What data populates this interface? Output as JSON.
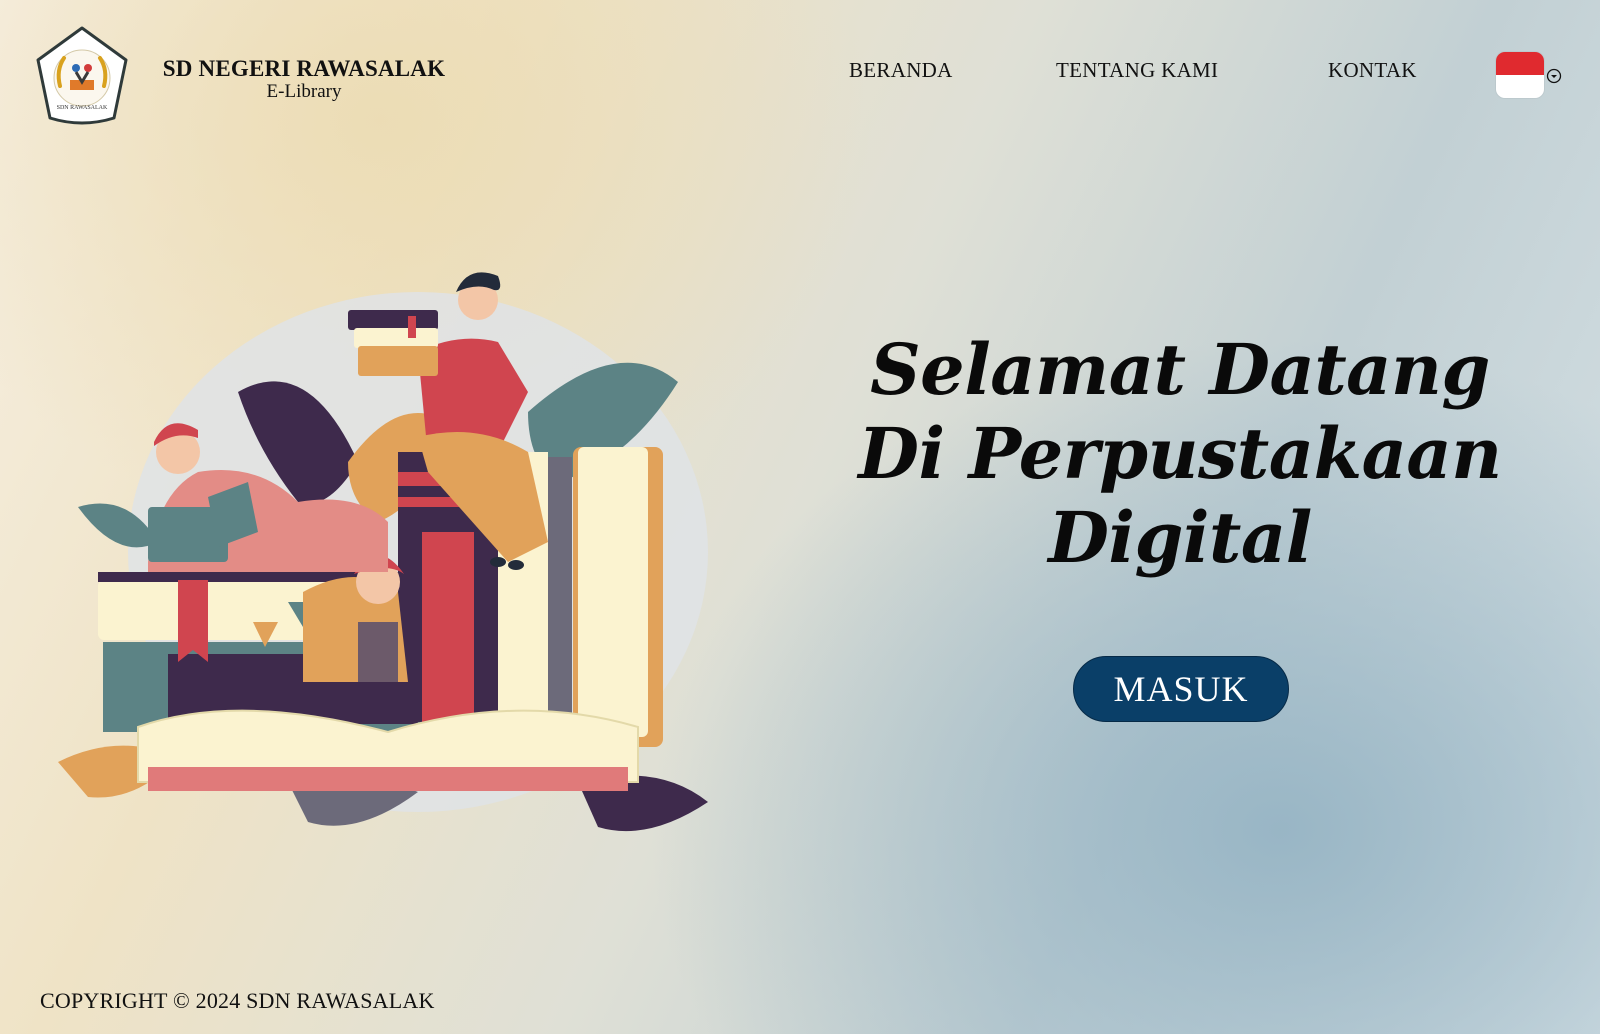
{
  "header": {
    "logo_icon": "school-emblem-icon",
    "logo_text": "SDN RAWASALAK",
    "school_name": "SD NEGERI RAWASALAK",
    "subtitle": "E-Library",
    "nav": [
      {
        "label": "BERANDA"
      },
      {
        "label": "TENTANG KAMI"
      },
      {
        "label": "KONTAK"
      }
    ],
    "language": {
      "flag_icon": "indonesia-flag-icon",
      "dropdown_icon": "chevron-down-circle-icon",
      "flag_colors": [
        "#e02a2f",
        "#ffffff"
      ]
    }
  },
  "hero": {
    "title_lines": [
      "Selamat Datang",
      "Di Perpustakaan",
      "Digital"
    ],
    "login_button": "MASUK",
    "illustration_icon": "people-reading-books-illustration"
  },
  "footer": {
    "copyright": "COPYRIGHT © 2024 SDN RAWASALAK"
  },
  "colors": {
    "button_bg": "#0a3f68",
    "text": "#111111",
    "accent_red": "#d0454f",
    "accent_teal": "#5c8385",
    "accent_orange": "#e1a25a",
    "accent_purple": "#3e2a4c"
  }
}
